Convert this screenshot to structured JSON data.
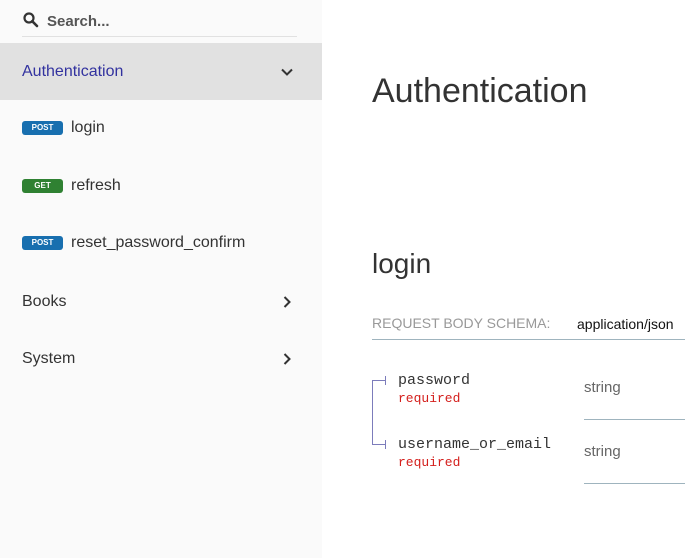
{
  "search": {
    "placeholder": "Search..."
  },
  "sidebar": {
    "groups": [
      {
        "label": "Authentication",
        "expanded": true
      },
      {
        "label": "Books",
        "expanded": false
      },
      {
        "label": "System",
        "expanded": false
      }
    ],
    "operations": [
      {
        "method": "POST",
        "label": "login"
      },
      {
        "method": "GET",
        "label": "refresh"
      },
      {
        "method": "POST",
        "label": "reset_password_confirm"
      }
    ]
  },
  "main": {
    "section_title": "Authentication",
    "operation_title": "login",
    "request_body": {
      "label": "Request Body schema:",
      "content_type": "application/json"
    },
    "properties": [
      {
        "name": "password",
        "required": "required",
        "type": "string"
      },
      {
        "name": "username_or_email",
        "required": "required",
        "type": "string"
      }
    ]
  },
  "colors": {
    "active_text": "#32329f",
    "post_badge": "#186faf",
    "get_badge": "#2f8132",
    "required": "#d41f1c"
  }
}
